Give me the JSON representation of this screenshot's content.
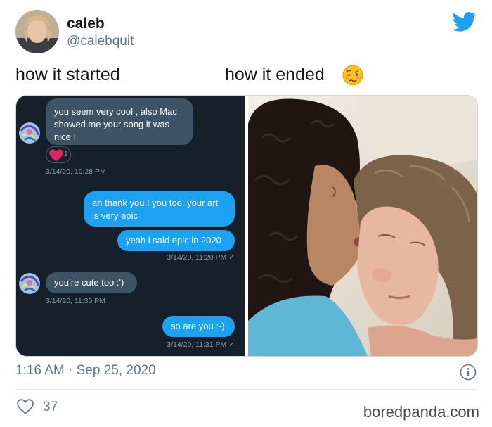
{
  "tweet": {
    "display_name": "caleb",
    "handle": "@calebquit",
    "caption_left": "how it started",
    "caption_right": "how it ended",
    "emoji": "woozy-face",
    "time": "1:16 AM · Sep 25, 2020",
    "likes": "37",
    "watermark": "boredpanda.com"
  },
  "chat": {
    "messages": [
      {
        "from": "them",
        "text": "you seem very cool , also Mac showed me your song it was nice !"
      },
      {
        "from": "me",
        "text": "ah thank you ! you too. your art is very epic"
      },
      {
        "from": "me",
        "text": "yeah i said epic in 2020"
      },
      {
        "from": "them",
        "text": "you’re cute too :')"
      },
      {
        "from": "me",
        "text": "so are you :-)"
      }
    ],
    "reaction_count": "1",
    "timestamps": [
      "3/14/20, 10:28 PM",
      "3/14/20, 11:20 PM ✓",
      "3/14/20, 11:30 PM",
      "3/14/20, 11:31 PM ✓"
    ]
  },
  "colors": {
    "twitter_blue": "#1da1f2",
    "chat_background": "#15202b",
    "incoming_bubble": "#3d5466",
    "outgoing_bubble": "#1da1f2",
    "muted_text": "#657786"
  }
}
